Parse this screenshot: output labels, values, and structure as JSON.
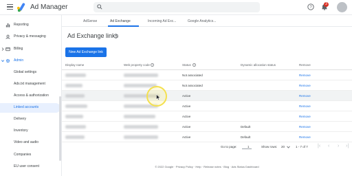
{
  "app": {
    "title": "Ad Manager",
    "brand_color": "#fbbc04",
    "notification_count": "3"
  },
  "sidebar": {
    "items": [
      {
        "label": "Reporting",
        "icon": "bar-chart-icon"
      },
      {
        "label": "Privacy & messaging",
        "icon": "privacy-icon"
      },
      {
        "label": "Billing",
        "icon": "billing-icon"
      },
      {
        "label": "Admin",
        "icon": "gear-icon"
      },
      {
        "label": "Global settings"
      },
      {
        "label": "Ads.txt management"
      },
      {
        "label": "Access & authorization"
      },
      {
        "label": "Linked accounts"
      },
      {
        "label": "Delivery"
      },
      {
        "label": "Inventory"
      },
      {
        "label": "Video and audio"
      },
      {
        "label": "Companies"
      },
      {
        "label": "EU user consent"
      }
    ]
  },
  "tabs": [
    {
      "label": "AdSense"
    },
    {
      "label": "Ad Exchange"
    },
    {
      "label": "Incoming Ad Exc..."
    },
    {
      "label": "Google Analytics..."
    }
  ],
  "page": {
    "title": "Ad Exchange links",
    "new_button": "New Ad Exchange link"
  },
  "table": {
    "headers": {
      "display_name": "Display name",
      "web_property": "Web property code",
      "status": "Status",
      "dynamic": "Dynamic allocation status",
      "remove": "Remove"
    },
    "rows": [
      {
        "status": "Not associated",
        "dynamic": "",
        "remove": "Remove"
      },
      {
        "status": "Not associated",
        "dynamic": "",
        "remove": "Remove"
      },
      {
        "status": "Active",
        "dynamic": "",
        "remove": "Remove"
      },
      {
        "status": "Active",
        "dynamic": "",
        "remove": "Remove"
      },
      {
        "status": "Active",
        "dynamic": "",
        "remove": "Remove"
      },
      {
        "status": "Active",
        "dynamic": "Default",
        "remove": "Remove"
      },
      {
        "status": "Active",
        "dynamic": "Default",
        "remove": "Remove"
      }
    ]
  },
  "pagination": {
    "goto_label": "Go to page:",
    "page_value": "1",
    "rows_label": "Show rows:",
    "rows_value": "20",
    "range": "1 - 7 of 7"
  },
  "footer": {
    "text": "© 2022 Google · Privacy Policy · Help · Release notes · Blog · Ads Status Dashboard"
  }
}
